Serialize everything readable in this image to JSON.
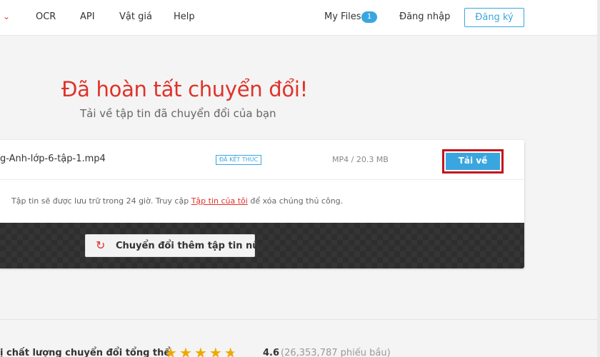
{
  "nav": {
    "links": [
      "OCR",
      "API",
      "Vật giá",
      "Help"
    ],
    "my_files": "My Files",
    "my_files_count": "1",
    "login": "Đăng nhập",
    "signup": "Đăng ký"
  },
  "page": {
    "title": "Đã hoàn tất chuyển đổi!",
    "subtitle": "Tải về tập tin đã chuyển đổi của bạn"
  },
  "file": {
    "name": "g-Anh-lớp-6-tập-1.mp4",
    "status": "ĐÃ KẾT THÚC",
    "info": "MP4 / 20.3 MB",
    "download_label": "Tải về"
  },
  "note": {
    "prefix": "Tập tin sẽ được lưu trữ trong 24 giờ. Truy cập ",
    "link": "Tập tin của tôi",
    "suffix": " để xóa chúng thủ công."
  },
  "convert_more": {
    "label": "Chuyển đổi thêm tập tin nữa",
    "icon": "refresh-icon"
  },
  "rating": {
    "label": "ị chất lượng chuyển đổi tổng thể",
    "stars": 4.6,
    "score": "4.6",
    "votes": "(26,353,787 phiếu bầu)"
  },
  "colors": {
    "accent_red": "#e0322a",
    "accent_blue": "#3aa6e0",
    "highlight_outline": "#c2141e"
  }
}
